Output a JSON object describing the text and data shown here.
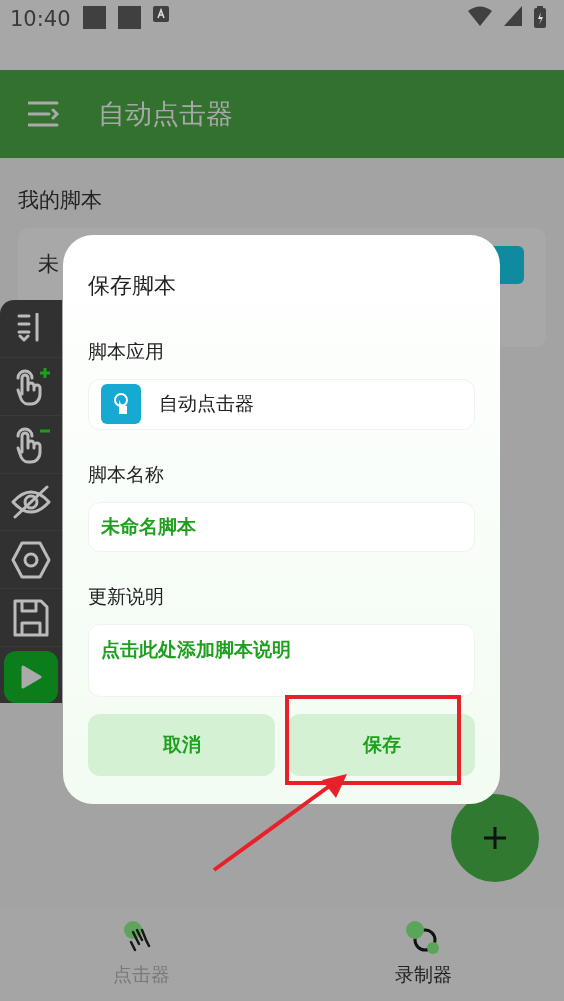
{
  "status_bar": {
    "time": "10:40"
  },
  "app_bar": {
    "title": "自动点击器"
  },
  "section_title": "我的脚本",
  "script_card": {
    "title": "未"
  },
  "dialog": {
    "title": "保存脚本",
    "fields": [
      {
        "kind": "app",
        "label": "脚本应用",
        "value": "自动点击器"
      },
      {
        "kind": "text",
        "label": "脚本名称",
        "value": "未命名脚本"
      },
      {
        "kind": "textarea",
        "label": "更新说明",
        "placeholder": "点击此处添加脚本说明"
      }
    ],
    "buttons": [
      {
        "label": "取消",
        "highlighted": false
      },
      {
        "label": "保存",
        "highlighted": true
      }
    ]
  },
  "bottom_nav": [
    {
      "label": "点击器",
      "selected": false
    },
    {
      "label": "录制器",
      "selected": true
    }
  ]
}
